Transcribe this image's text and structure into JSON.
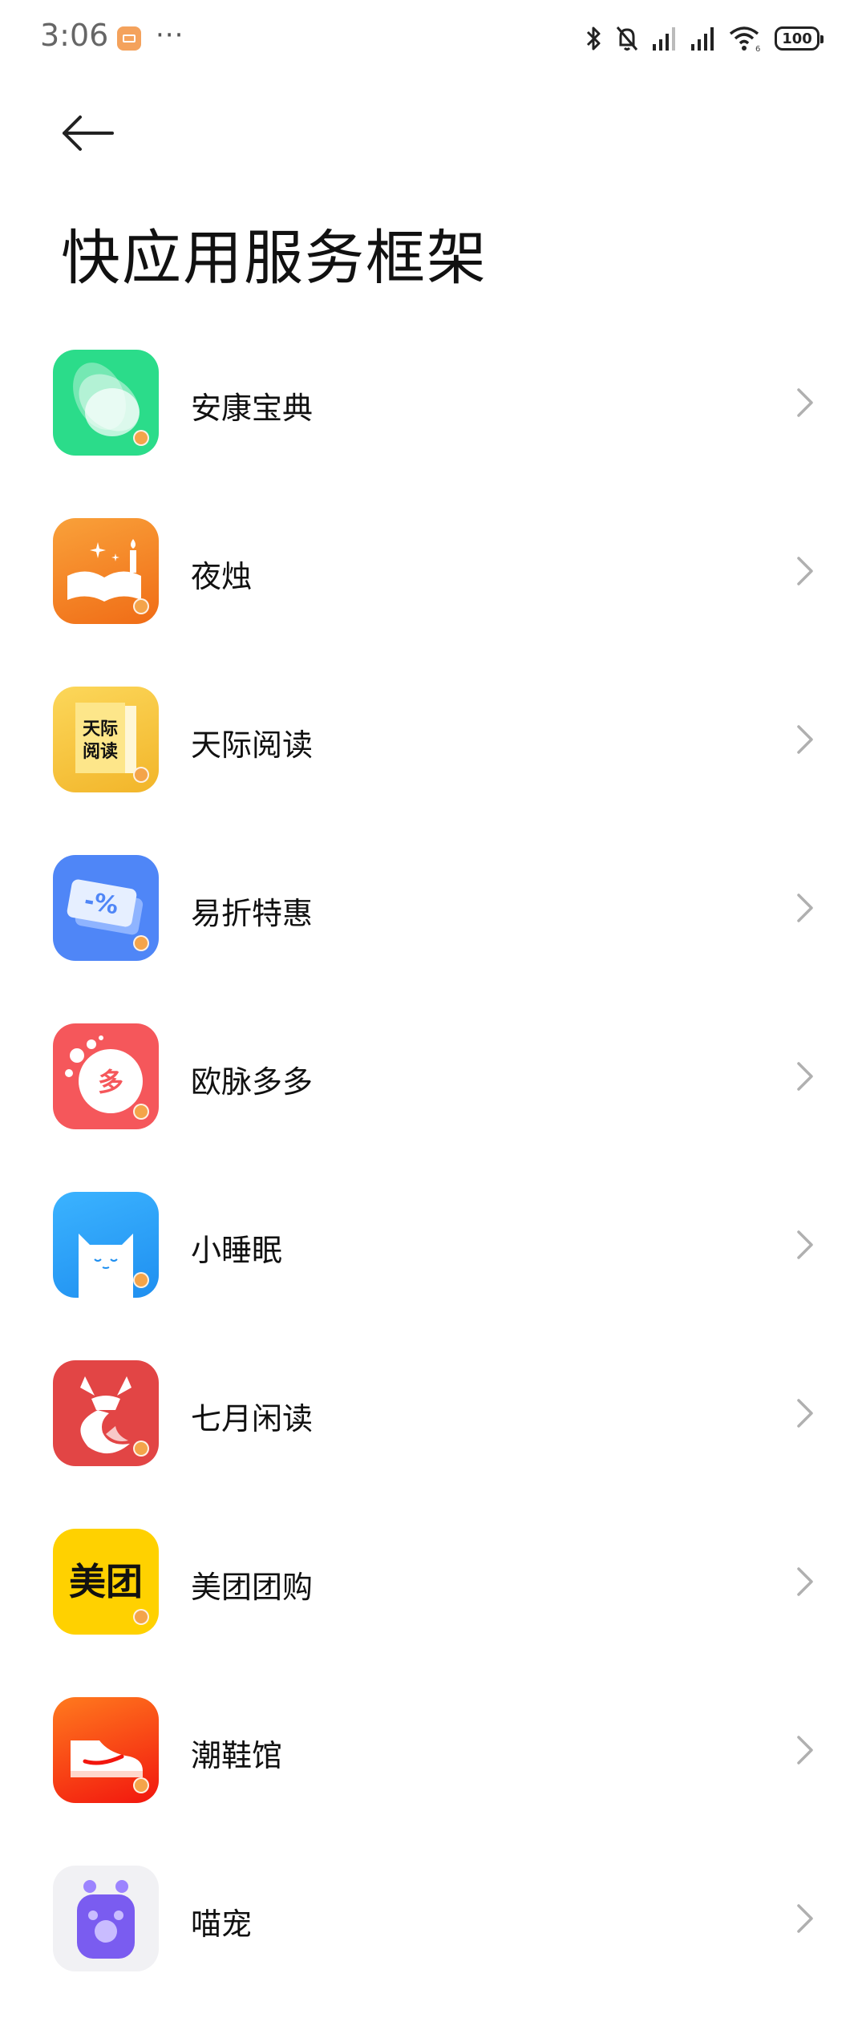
{
  "status_bar": {
    "time": "3:06",
    "more": "···",
    "battery": "100",
    "wifi_label": "6"
  },
  "header": {
    "title": "快应用服务框架"
  },
  "apps": [
    {
      "name": "安康宝典",
      "icon": "leaf-layers-icon",
      "color": "#2bdc8a"
    },
    {
      "name": "夜烛",
      "icon": "open-book-candle-icon",
      "color": "#f58a25"
    },
    {
      "name": "天际阅读",
      "icon": "yellow-book-icon",
      "color": "#f6c53a",
      "icon_text": "天际阅读"
    },
    {
      "name": "易折特惠",
      "icon": "discount-ticket-icon",
      "color": "#4f86f7",
      "icon_text": "-%"
    },
    {
      "name": "欧脉多多",
      "icon": "bubble-duo-icon",
      "color": "#f5575b",
      "icon_text": "多"
    },
    {
      "name": "小睡眠",
      "icon": "sleeping-cat-icon",
      "color": "#25a3f5"
    },
    {
      "name": "七月闲读",
      "icon": "deer-icon",
      "color": "#e24545"
    },
    {
      "name": "美团团购",
      "icon": "meituan-logo-icon",
      "color": "#ffd100",
      "icon_text": "美团"
    },
    {
      "name": "潮鞋馆",
      "icon": "sneaker-icon",
      "color": "#f93a1e"
    },
    {
      "name": "喵宠",
      "icon": "cat-paw-icon",
      "color": "#7a5cf0"
    }
  ]
}
